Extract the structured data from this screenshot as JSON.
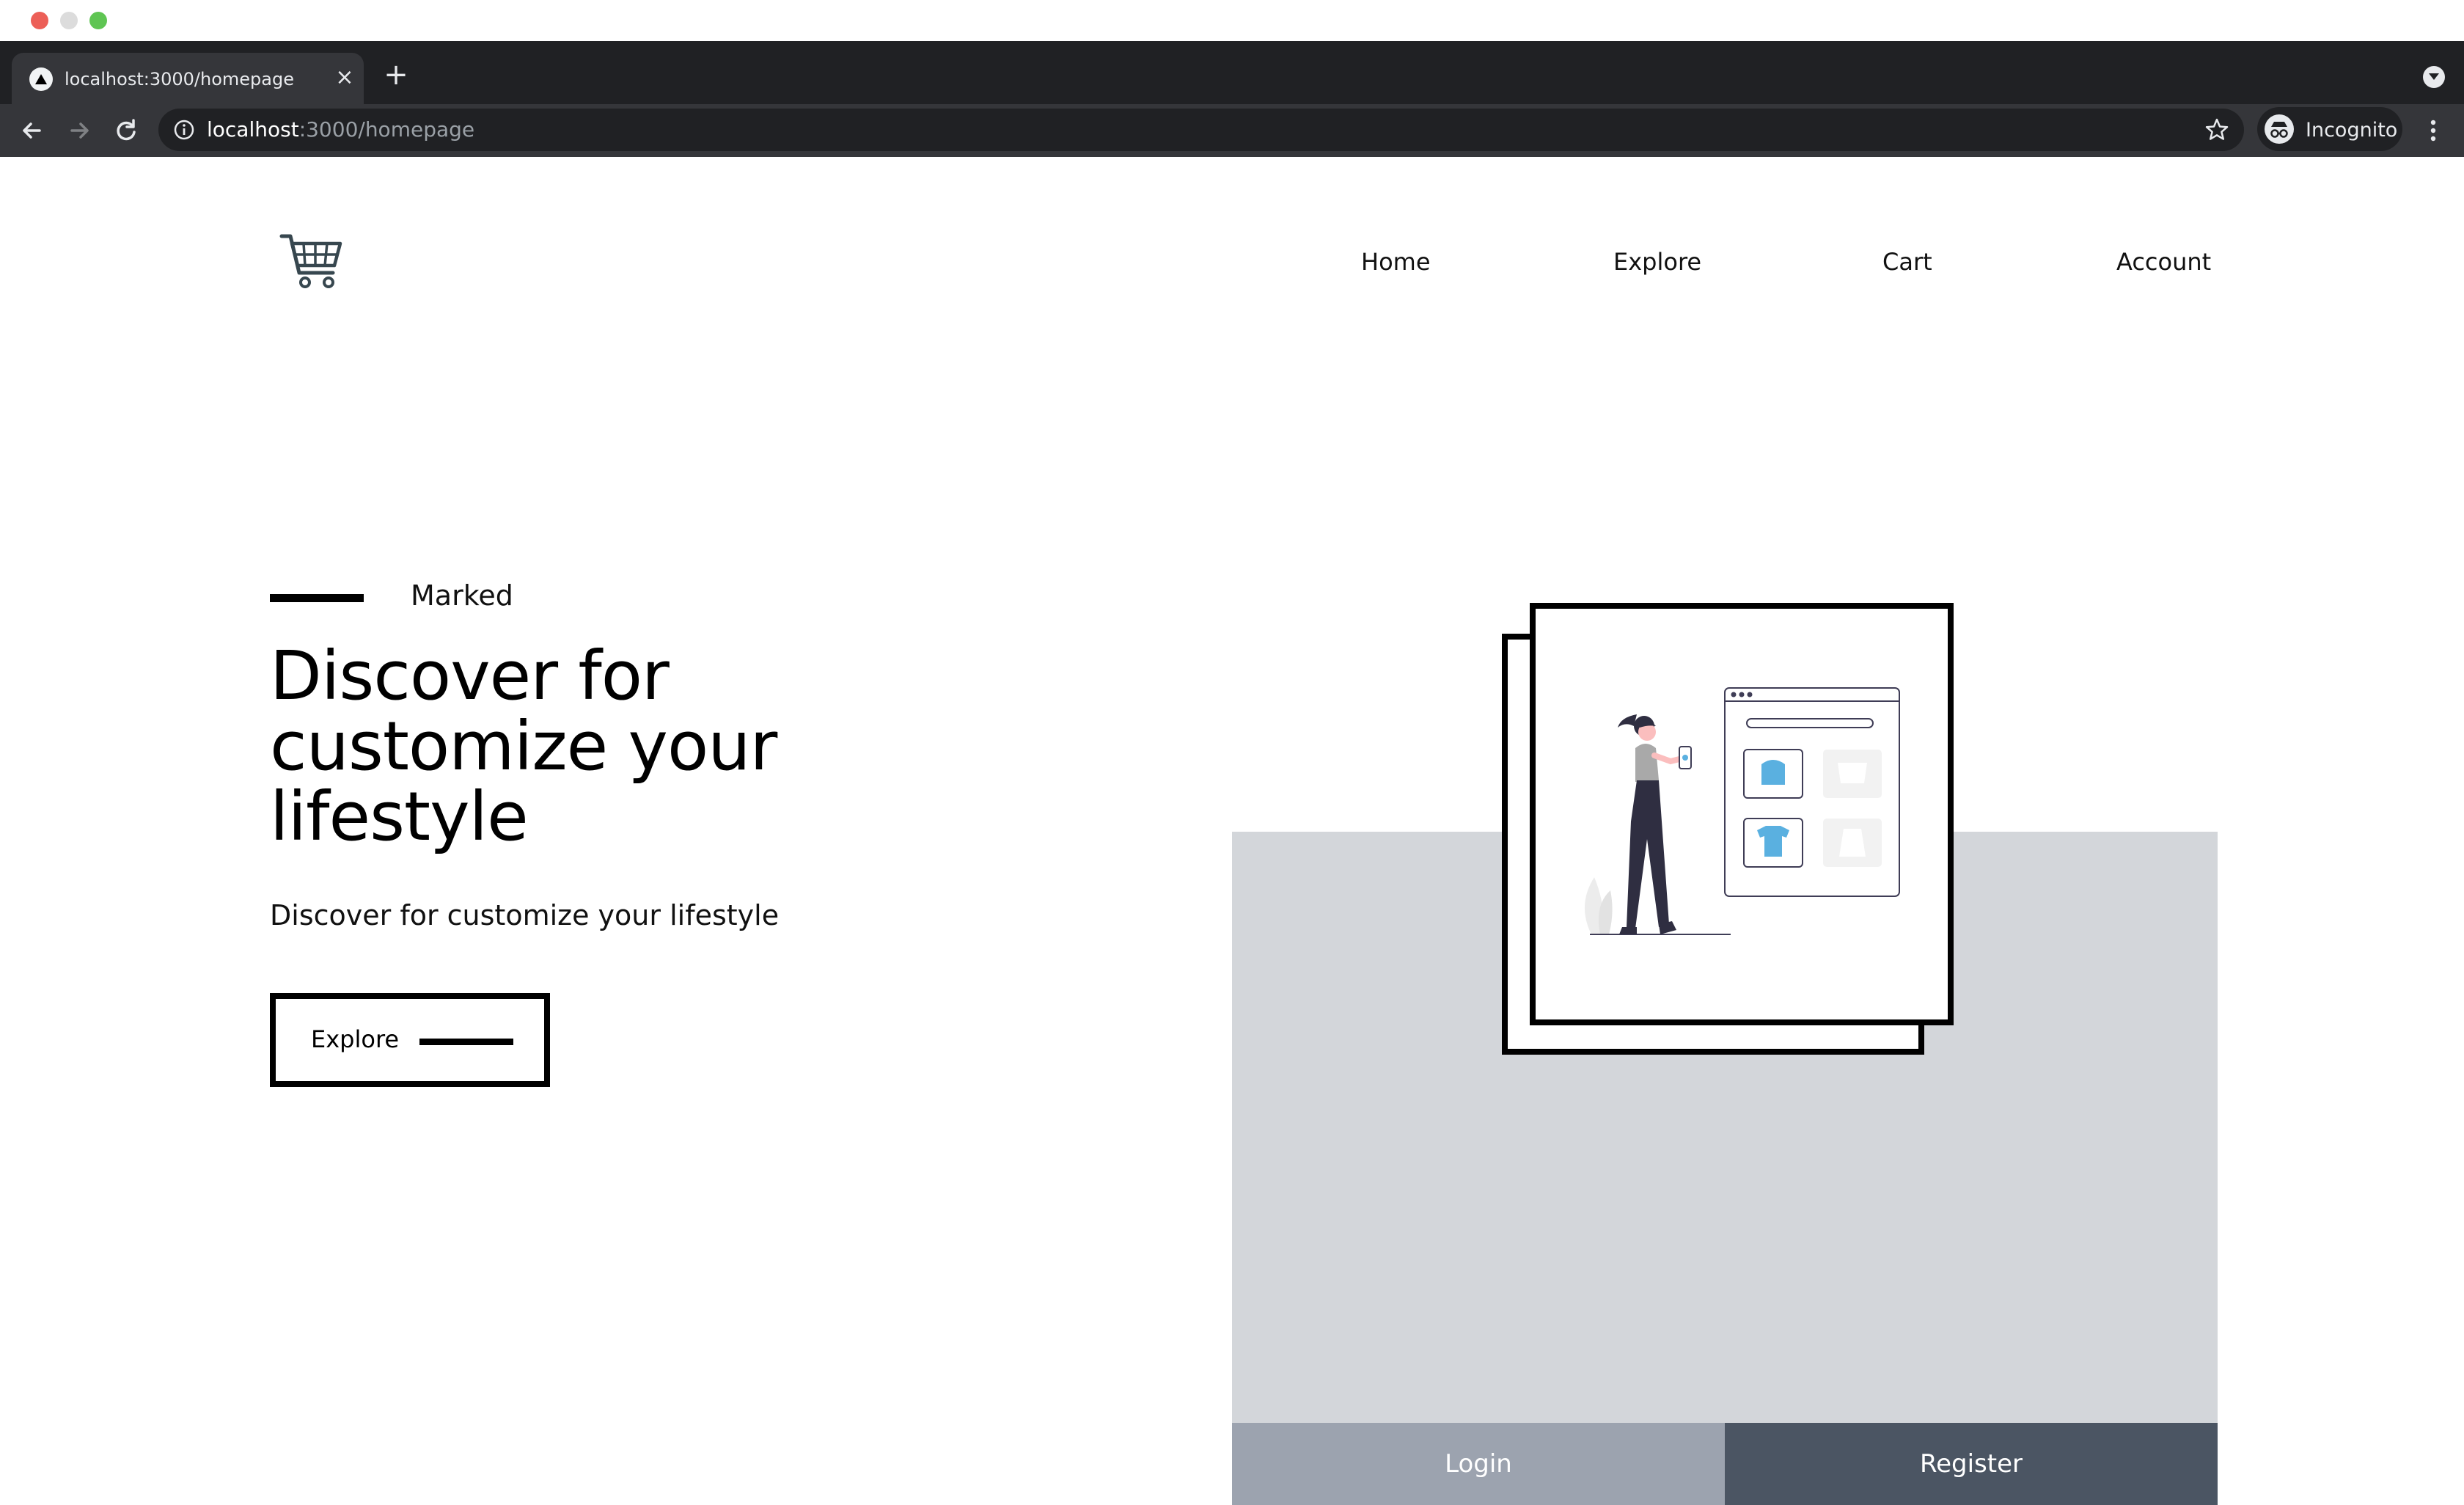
{
  "browser": {
    "tab_title": "localhost:3000/homepage",
    "tab_close": "×",
    "new_tab": "+",
    "url_host": "localhost",
    "url_path": ":3000/homepage",
    "profile_label": "Incognito"
  },
  "header": {
    "logo_icon": "shopping-cart-icon",
    "nav": [
      "Home",
      "Explore",
      "Cart",
      "Account"
    ]
  },
  "hero": {
    "eyebrow": "Marked",
    "headline": "Discover for customize your lifestyle",
    "subheadline": "Discover for customize your lifestyle",
    "cta_label": "Explore"
  },
  "auth": {
    "login_label": "Login",
    "register_label": "Register"
  },
  "colors": {
    "panel": "#d3d6da",
    "login": "#9ca3af",
    "register": "#4b5563",
    "accent": "#5ab0e0"
  }
}
